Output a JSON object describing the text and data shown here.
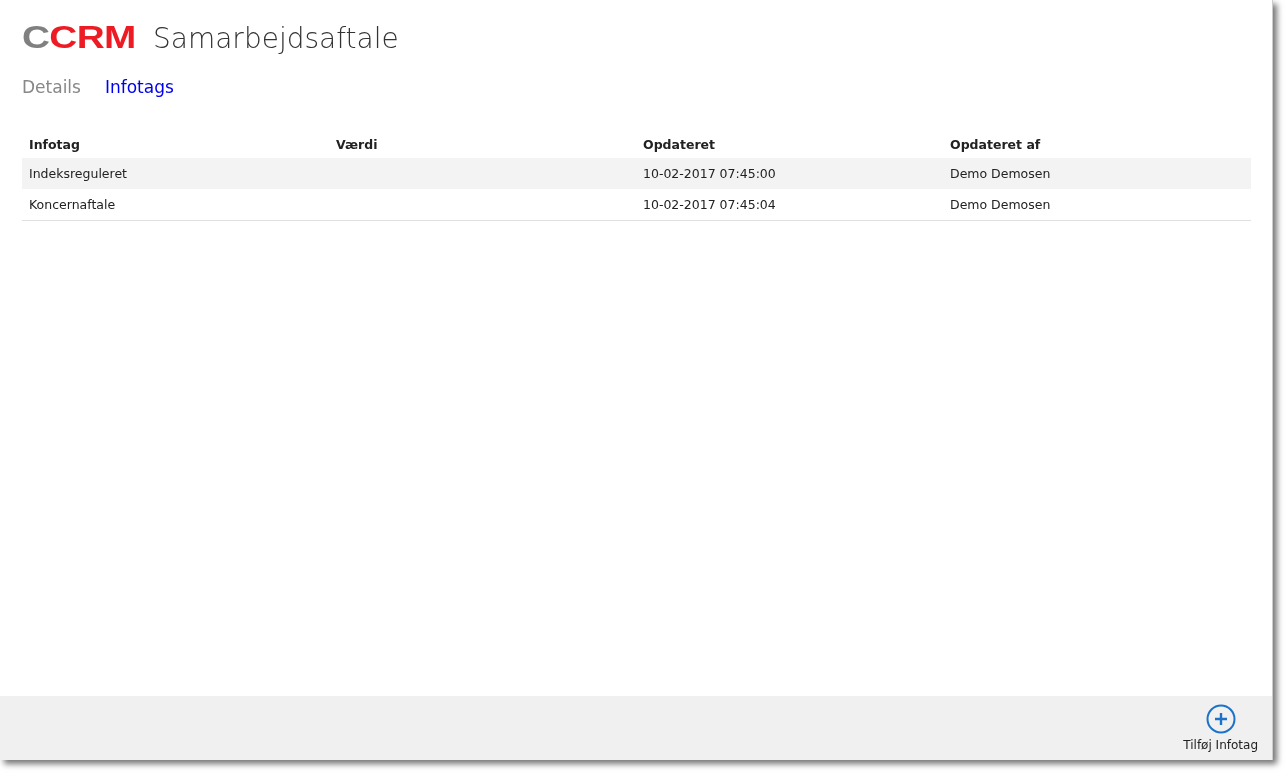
{
  "logo": {
    "part_1": "C",
    "part_2": "CRM"
  },
  "title": "Samarbejdsaftale",
  "tabs": [
    {
      "label": "Details",
      "selected": false
    },
    {
      "label": "Infotags",
      "selected": true
    }
  ],
  "table": {
    "columns": [
      "Infotag",
      "Værdi",
      "Opdateret",
      "Opdateret af"
    ],
    "rows": [
      [
        "Indeksreguleret",
        "",
        "10-02-2017 07:45:00",
        "Demo Demosen"
      ],
      [
        "Koncernaftale",
        "",
        "10-02-2017 07:45:04",
        "Demo Demosen"
      ]
    ]
  },
  "footer": {
    "add_button": "Tilføj Infotag"
  }
}
